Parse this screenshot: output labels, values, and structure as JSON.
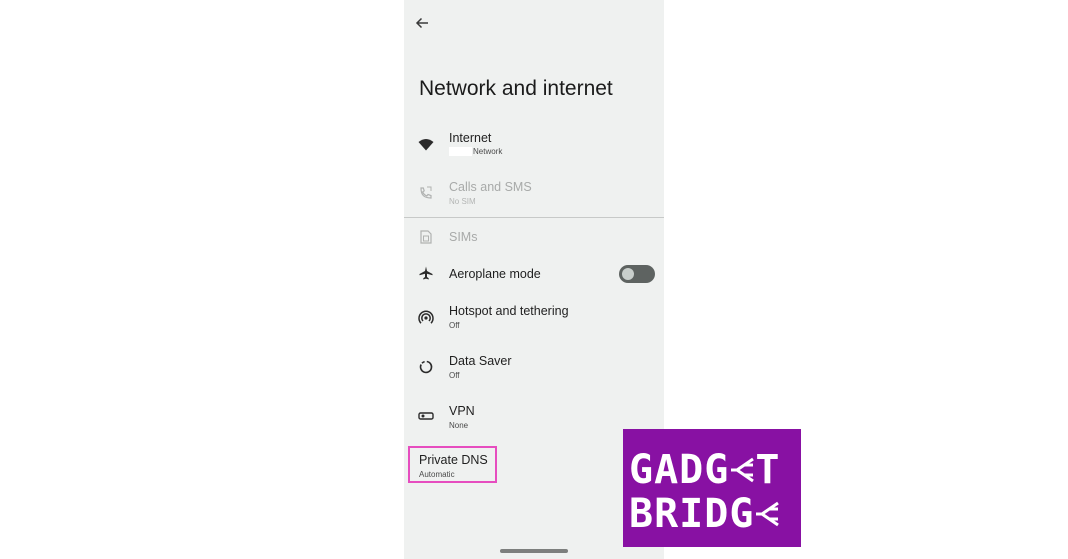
{
  "header": {
    "back_icon": "arrow-back-icon"
  },
  "title": "Network and internet",
  "items": [
    {
      "id": "internet",
      "label": "Internet",
      "sub": "Network",
      "icon": "wifi-icon",
      "enabled": true
    },
    {
      "id": "calls",
      "label": "Calls and SMS",
      "sub": "No SIM",
      "icon": "phone-icon",
      "enabled": false
    },
    {
      "id": "sims",
      "label": "SIMs",
      "icon": "sim-card-icon",
      "enabled": false
    },
    {
      "id": "aeroplane",
      "label": "Aeroplane mode",
      "icon": "airplane-icon",
      "toggle": "off",
      "enabled": true
    },
    {
      "id": "hotspot",
      "label": "Hotspot and tethering",
      "sub": "Off",
      "icon": "hotspot-icon",
      "enabled": true
    },
    {
      "id": "datasaver",
      "label": "Data Saver",
      "sub": "Off",
      "icon": "data-saver-icon",
      "enabled": true
    },
    {
      "id": "vpn",
      "label": "VPN",
      "sub": "None",
      "icon": "vpn-key-icon",
      "enabled": true
    },
    {
      "id": "dns",
      "label": "Private DNS",
      "sub": "Automatic",
      "highlighted": true,
      "enabled": true
    }
  ],
  "logo": {
    "line1": "GADG",
    "line1_end": "T",
    "line2": "BRIDG"
  },
  "colors": {
    "background": "#eff1f0",
    "highlight": "#e64dbf",
    "logo_bg": "#8811a3",
    "toggle_off": "#5e6361"
  }
}
